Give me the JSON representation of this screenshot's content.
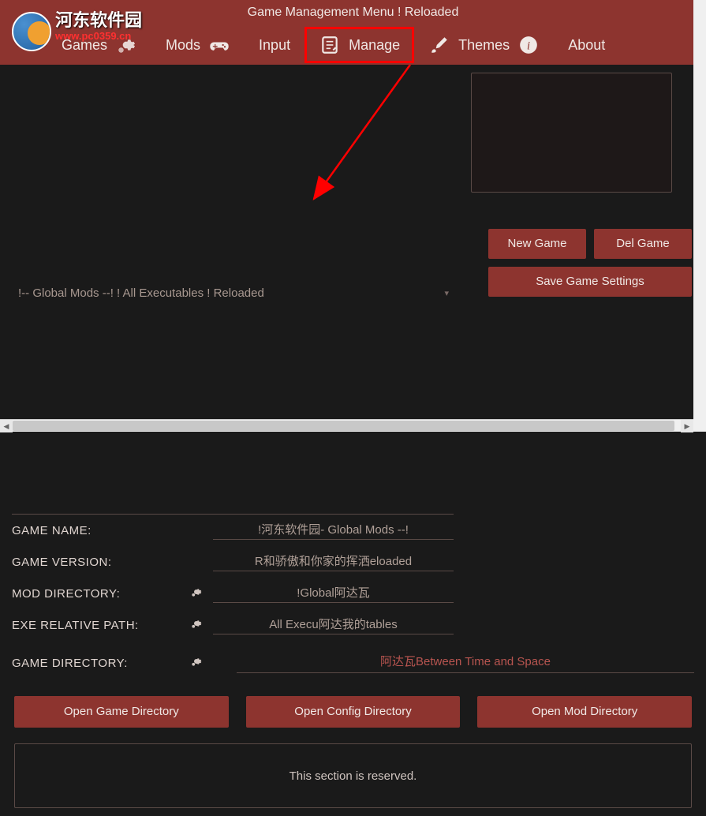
{
  "window": {
    "title": "Game Management Menu ! Reloaded"
  },
  "watermark": {
    "text": "河东软件园",
    "url": "www.pc0359.cn"
  },
  "menu": {
    "items": [
      {
        "label": "Games",
        "icon": "gears-icon"
      },
      {
        "label": "Mods",
        "icon": "gamepad-icon"
      },
      {
        "label": "Input",
        "icon": "clipboard-icon"
      },
      {
        "label": "Manage",
        "icon": "paintbrush-icon",
        "highlighted": true
      },
      {
        "label": "Themes",
        "icon": "info-icon"
      },
      {
        "label": "About",
        "icon": null
      }
    ]
  },
  "dropdown": {
    "selected": "!-- Global Mods --! ! All Executables ! Reloaded"
  },
  "fields": {
    "game_name": {
      "label": "GAME NAME:",
      "value": "!河东软件园- Global Mods --!"
    },
    "game_version": {
      "label": "GAME VERSION:",
      "value": "R和骄傲和你家的挥洒eloaded"
    },
    "mod_directory": {
      "label": "MOD DIRECTORY:",
      "value": "!Global阿达瓦",
      "has_gear": true
    },
    "exe_relative_path": {
      "label": "EXE RELATIVE PATH:",
      "value": "All Execu阿达我的tables",
      "has_gear": true
    },
    "game_directory": {
      "label": "GAME DIRECTORY:",
      "value": "阿达瓦Between Time and Space",
      "has_gear": true
    }
  },
  "buttons": {
    "new_game": "New Game",
    "del_game": "Del Game",
    "save_settings": "Save Game Settings",
    "open_game_dir": "Open Game Directory",
    "open_config_dir": "Open Config Directory",
    "open_mod_dir": "Open Mod Directory"
  },
  "reserved": {
    "text": "This section is reserved."
  }
}
